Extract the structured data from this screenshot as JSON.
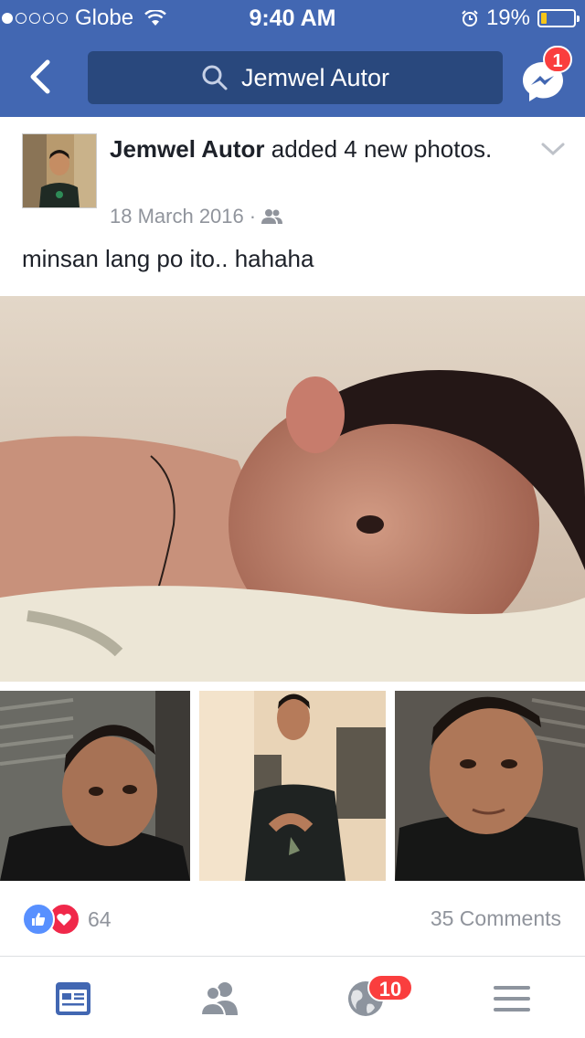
{
  "status_bar": {
    "carrier": "Globe",
    "signal_dots_filled": 1,
    "signal_dots_total": 5,
    "time": "9:40 AM",
    "battery_percent": "19%",
    "battery_level": 0.19
  },
  "nav": {
    "search_text": "Jemwel Autor",
    "messenger_badge": "1",
    "colors": {
      "bar": "#4267b2",
      "search": "#29487d",
      "badge": "#fa3e3e"
    }
  },
  "post": {
    "author": "Jemwel Autor",
    "action": " added 4 new photos.",
    "date": "18 March 2016",
    "separator": "·",
    "audience_icon": "friends-icon",
    "caption": "minsan lang po ito.. hahaha",
    "reactions": {
      "icons": [
        "like-icon",
        "love-icon"
      ],
      "count": "64"
    },
    "comments": "35 Comments"
  },
  "tabbar": {
    "tabs": [
      "news-feed-icon",
      "friend-requests-icon",
      "notifications-icon",
      "menu-icon"
    ],
    "notifications_badge": "10",
    "active_color": "#4267b2",
    "inactive_color": "#8d949e"
  }
}
